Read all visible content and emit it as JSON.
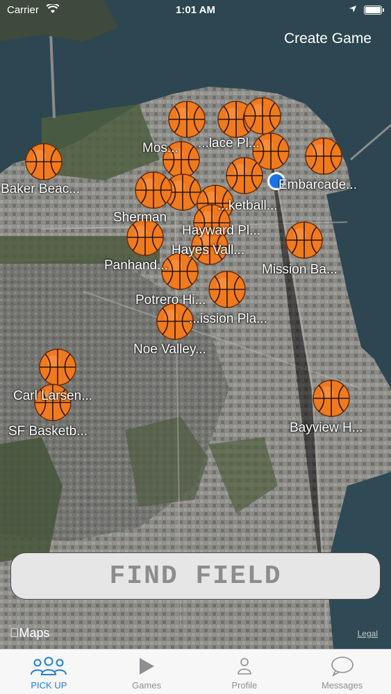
{
  "status_bar": {
    "carrier": "Carrier",
    "time": "1:01 AM"
  },
  "header": {
    "create_game_label": "Create Game"
  },
  "map": {
    "markers": [
      {
        "label": "Baker Beac..."
      },
      {
        "label": "Mos..."
      },
      {
        "label": "...lace Pl..."
      },
      {
        "label": "Sherman"
      },
      {
        "label": "...ketball..."
      },
      {
        "label": "Hayward Pl..."
      },
      {
        "label": "Hayes Vall..."
      },
      {
        "label": "Embarcade..."
      },
      {
        "label": "Panhand..."
      },
      {
        "label": "Mission Ba..."
      },
      {
        "label": "Potrero Hi..."
      },
      {
        "label": "...ission Pla..."
      },
      {
        "label": "Noe Valley..."
      },
      {
        "label": "Carl Larsen..."
      },
      {
        "label": "SF Basketb..."
      },
      {
        "label": "Bayview H..."
      }
    ]
  },
  "find_field": {
    "label": "FIND FIELD"
  },
  "attribution": {
    "maps_label": "Maps",
    "legal_label": "Legal"
  },
  "tab_bar": {
    "tabs": [
      {
        "label": "PICK UP",
        "icon": "people-icon",
        "active": true
      },
      {
        "label": "Games",
        "icon": "play-icon",
        "active": false
      },
      {
        "label": "Profile",
        "icon": "person-icon",
        "active": false
      },
      {
        "label": "Messages",
        "icon": "chat-bubble-icon",
        "active": false
      }
    ]
  },
  "colors": {
    "accent": "#1e7fd6",
    "ball": "#f07a1e",
    "button_bg": "#e6e6e6"
  }
}
